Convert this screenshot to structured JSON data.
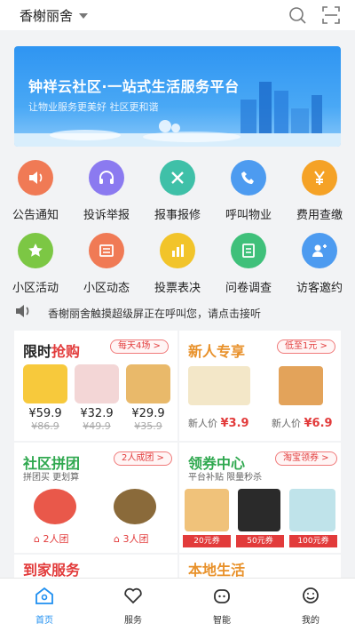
{
  "header": {
    "community_name": "香榭丽舍"
  },
  "banner": {
    "title": "钟祥云社区·一站式生活服务平台",
    "subtitle": "让物业服务更美好  社区更和谐"
  },
  "services": [
    {
      "label": "公告通知",
      "icon": "speaker-icon",
      "color": "#f07a55"
    },
    {
      "label": "投诉举报",
      "icon": "headset-icon",
      "color": "#8b7af0"
    },
    {
      "label": "报事报修",
      "icon": "tools-icon",
      "color": "#3fc0a8"
    },
    {
      "label": "呼叫物业",
      "icon": "phone-icon",
      "color": "#4d9bf0"
    },
    {
      "label": "费用查缴",
      "icon": "yen-icon",
      "color": "#f5a226"
    },
    {
      "label": "小区活动",
      "icon": "star-icon",
      "color": "#7cc744"
    },
    {
      "label": "小区动态",
      "icon": "news-icon",
      "color": "#f07a55"
    },
    {
      "label": "投票表决",
      "icon": "bar-chart-icon",
      "color": "#f2c42a"
    },
    {
      "label": "问卷调查",
      "icon": "survey-icon",
      "color": "#3fc07a"
    },
    {
      "label": "访客邀约",
      "icon": "visitor-icon",
      "color": "#4d9bf0"
    }
  ],
  "notice": {
    "text": "香榭丽舍触摸超级屏正在呼叫您，请点击接听"
  },
  "flash_sale": {
    "title_a": "限时",
    "title_b": "抢购",
    "badge": "每天4场 >",
    "items": [
      {
        "price": "¥59.9",
        "old": "¥86.9"
      },
      {
        "price": "¥32.9",
        "old": "¥49.9"
      },
      {
        "price": "¥29.9",
        "old": "¥35.9"
      }
    ]
  },
  "new_user": {
    "title": "新人专享",
    "badge": "低至1元 >",
    "items": [
      {
        "label": "新人价",
        "price": "¥3.9"
      },
      {
        "label": "新人价",
        "price": "¥6.9"
      }
    ]
  },
  "group_buy": {
    "title": "社区拼团",
    "badge": "2人成团 >",
    "subtitle": "拼团买  更划算",
    "items": [
      {
        "label": "2人团"
      },
      {
        "label": "3人团"
      }
    ]
  },
  "coupons": {
    "title": "领券中心",
    "badge": "淘宝领券 >",
    "subtitle": "平台补贴  限量秒杀",
    "items": [
      {
        "label": "20元券"
      },
      {
        "label": "50元券"
      },
      {
        "label": "100元券"
      }
    ]
  },
  "home_service": {
    "title": "到家服务"
  },
  "local_life": {
    "title": "本地生活"
  },
  "nav": [
    {
      "label": "首页",
      "icon": "home-icon",
      "active": true
    },
    {
      "label": "服务",
      "icon": "heart-icon",
      "active": false
    },
    {
      "label": "智能",
      "icon": "robot-icon",
      "active": false
    },
    {
      "label": "我的",
      "icon": "smile-icon",
      "active": false
    }
  ],
  "colors": {
    "accent": "#1f8ff0",
    "promo_red": "#e23b3b",
    "green_title": "#2fa84f",
    "orange_title": "#e8912a"
  }
}
